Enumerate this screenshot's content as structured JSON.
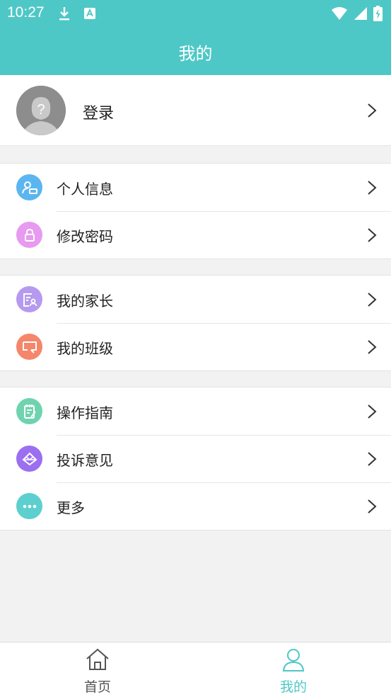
{
  "status_bar": {
    "time": "10:27"
  },
  "header": {
    "title": "我的"
  },
  "profile": {
    "login_label": "登录"
  },
  "groups": [
    {
      "items": [
        {
          "label": "个人信息",
          "icon": "person-card-icon",
          "color": "#5bb5f0"
        },
        {
          "label": "修改密码",
          "icon": "lock-icon",
          "color": "#e79af0"
        }
      ]
    },
    {
      "items": [
        {
          "label": "我的家长",
          "icon": "parent-document-icon",
          "color": "#b59af0"
        },
        {
          "label": "我的班级",
          "icon": "class-board-icon",
          "color": "#f5866a"
        }
      ]
    },
    {
      "items": [
        {
          "label": "操作指南",
          "icon": "guide-notepad-icon",
          "color": "#6fd3b0"
        },
        {
          "label": "投诉意见",
          "icon": "feedback-envelope-icon",
          "color": "#9b6ff0"
        },
        {
          "label": "更多",
          "icon": "more-dots-icon",
          "color": "#5dcfcf"
        }
      ]
    }
  ],
  "tabs": [
    {
      "label": "首页",
      "icon": "home-icon",
      "active": false
    },
    {
      "label": "我的",
      "icon": "user-icon",
      "active": true
    }
  ],
  "colors": {
    "primary": "#4ec8c6",
    "tab_inactive": "#555555"
  }
}
